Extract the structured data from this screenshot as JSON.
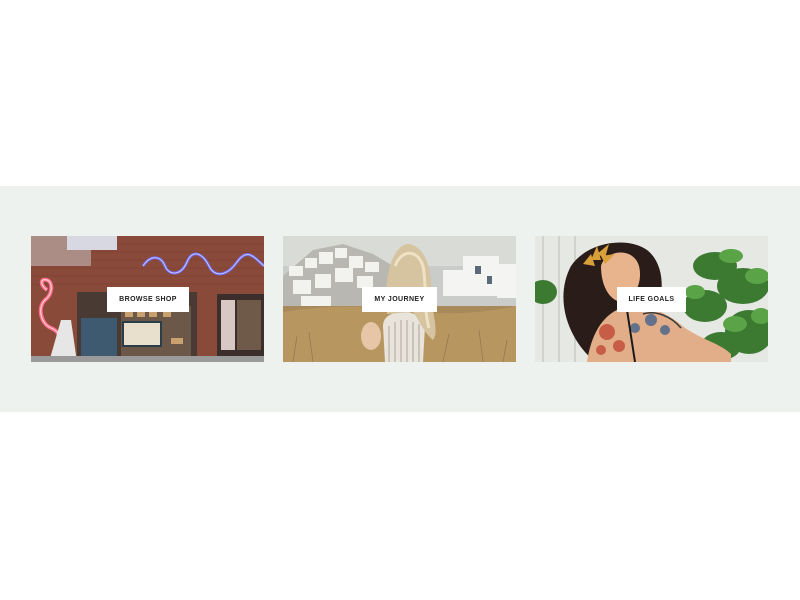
{
  "features": {
    "tiles": [
      {
        "label": "Browse Shop",
        "image": "neon-storefront-photo"
      },
      {
        "label": "My Journey",
        "image": "whitewashed-village-photo"
      },
      {
        "label": "Life Goals",
        "image": "tattooed-woman-plants-photo"
      }
    ]
  },
  "colors": {
    "band_background": "#eef2ee",
    "page_background": "#ffffff",
    "label_background": "#ffffff",
    "label_text": "#1e1e1e"
  }
}
